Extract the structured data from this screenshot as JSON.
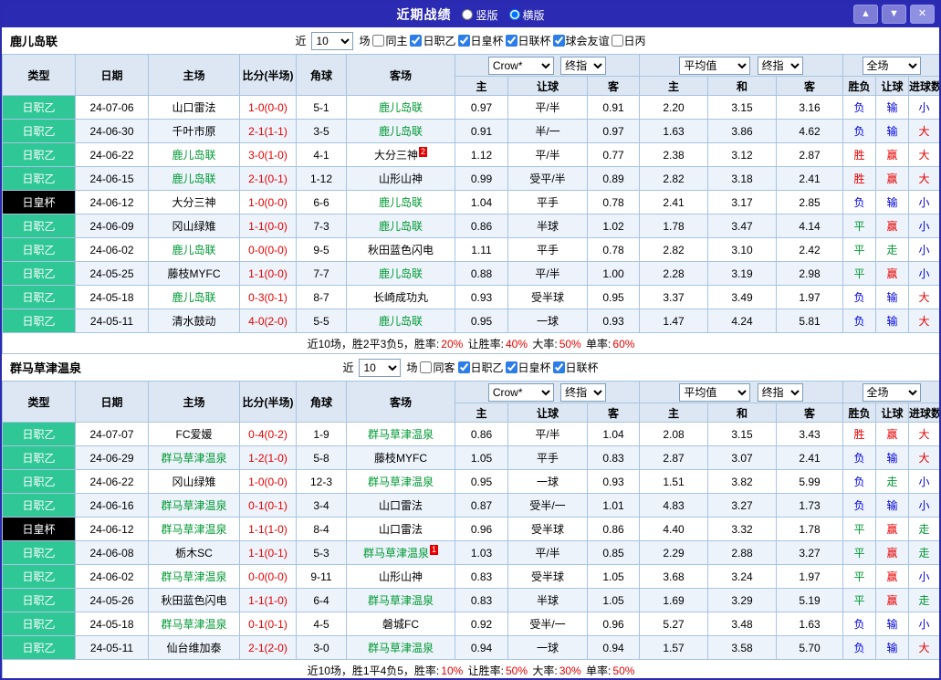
{
  "titlebar": {
    "title": "近期战绩",
    "layout_options": [
      {
        "label": "竖版",
        "selected": false
      },
      {
        "label": "横版",
        "selected": true
      }
    ],
    "buttons": [
      {
        "name": "scroll-up",
        "glyph": "▲"
      },
      {
        "name": "scroll-down",
        "glyph": "▼"
      },
      {
        "name": "close",
        "glyph": "✕"
      }
    ]
  },
  "table_header": {
    "cols": [
      "类型",
      "日期",
      "主场",
      "比分(半场)",
      "角球",
      "客场"
    ],
    "asian": {
      "bookmaker": "Crow*",
      "stage": "终指",
      "sub": [
        "主",
        "让球",
        "客"
      ]
    },
    "euro": {
      "source": "平均值",
      "stage": "终指",
      "sub": [
        "主",
        "和",
        "客"
      ]
    },
    "result": {
      "scope": "全场",
      "sub": [
        "胜负",
        "让球",
        "进球数"
      ]
    }
  },
  "league_colors": {
    "日职乙": "#2fc795",
    "日皇杯": "#000000"
  },
  "outcome_colors": {
    "胜": "r",
    "赢": "r",
    "大": "r",
    "负": "b",
    "输": "b",
    "小": "b",
    "平": "g",
    "走": "g"
  },
  "palette": {
    "r": "#e60000",
    "b": "#0000d9",
    "g": "#009933",
    "k": "#000000"
  },
  "sections": [
    {
      "team": "鹿儿岛联",
      "filters": {
        "near": "近",
        "count": "10",
        "games": "场",
        "same": {
          "label": "同主",
          "checked": false
        },
        "leagues": [
          {
            "label": "日职乙",
            "checked": true
          },
          {
            "label": "日皇杯",
            "checked": true
          },
          {
            "label": "日联杯",
            "checked": true
          },
          {
            "label": "球会友谊",
            "checked": true
          },
          {
            "label": "日丙",
            "checked": false
          }
        ]
      },
      "rows": [
        {
          "league": "日职乙",
          "date": "24-07-06",
          "home": "山口雷法",
          "home_focus": false,
          "score": "1-0(0-0)",
          "corner": "5-1",
          "away": "鹿儿岛联",
          "away_focus": true,
          "away_badge": "",
          "asian": [
            "0.97",
            "平/半",
            "0.91"
          ],
          "euro": [
            "2.20",
            "3.15",
            "3.16"
          ],
          "outcome": [
            "负",
            "输",
            "小"
          ]
        },
        {
          "league": "日职乙",
          "date": "24-06-30",
          "home": "千叶市原",
          "home_focus": false,
          "score": "2-1(1-1)",
          "corner": "3-5",
          "away": "鹿儿岛联",
          "away_focus": true,
          "away_badge": "",
          "asian": [
            "0.91",
            "半/一",
            "0.97"
          ],
          "euro": [
            "1.63",
            "3.86",
            "4.62"
          ],
          "outcome": [
            "负",
            "输",
            "大"
          ]
        },
        {
          "league": "日职乙",
          "date": "24-06-22",
          "home": "鹿儿岛联",
          "home_focus": true,
          "score": "3-0(1-0)",
          "corner": "4-1",
          "away": "大分三神",
          "away_focus": false,
          "away_badge": "2",
          "asian": [
            "1.12",
            "平/半",
            "0.77"
          ],
          "euro": [
            "2.38",
            "3.12",
            "2.87"
          ],
          "outcome": [
            "胜",
            "赢",
            "大"
          ]
        },
        {
          "league": "日职乙",
          "date": "24-06-15",
          "home": "鹿儿岛联",
          "home_focus": true,
          "score": "2-1(0-1)",
          "corner": "1-12",
          "away": "山形山神",
          "away_focus": false,
          "away_badge": "",
          "asian": [
            "0.99",
            "受平/半",
            "0.89"
          ],
          "euro": [
            "2.82",
            "3.18",
            "2.41"
          ],
          "outcome": [
            "胜",
            "赢",
            "大"
          ]
        },
        {
          "league": "日皇杯",
          "date": "24-06-12",
          "home": "大分三神",
          "home_focus": false,
          "score": "1-0(0-0)",
          "corner": "6-6",
          "away": "鹿儿岛联",
          "away_focus": true,
          "away_badge": "",
          "asian": [
            "1.04",
            "平手",
            "0.78"
          ],
          "euro": [
            "2.41",
            "3.17",
            "2.85"
          ],
          "outcome": [
            "负",
            "输",
            "小"
          ]
        },
        {
          "league": "日职乙",
          "date": "24-06-09",
          "home": "冈山绿雉",
          "home_focus": false,
          "score": "1-1(0-0)",
          "corner": "7-3",
          "away": "鹿儿岛联",
          "away_focus": true,
          "away_badge": "",
          "asian": [
            "0.86",
            "半球",
            "1.02"
          ],
          "euro": [
            "1.78",
            "3.47",
            "4.14"
          ],
          "outcome": [
            "平",
            "赢",
            "小"
          ]
        },
        {
          "league": "日职乙",
          "date": "24-06-02",
          "home": "鹿儿岛联",
          "home_focus": true,
          "score": "0-0(0-0)",
          "corner": "9-5",
          "away": "秋田蓝色闪电",
          "away_focus": false,
          "away_badge": "",
          "asian": [
            "1.11",
            "平手",
            "0.78"
          ],
          "euro": [
            "2.82",
            "3.10",
            "2.42"
          ],
          "outcome": [
            "平",
            "走",
            "小"
          ]
        },
        {
          "league": "日职乙",
          "date": "24-05-25",
          "home": "藤枝MYFC",
          "home_focus": false,
          "score": "1-1(0-0)",
          "corner": "7-7",
          "away": "鹿儿岛联",
          "away_focus": true,
          "away_badge": "",
          "asian": [
            "0.88",
            "平/半",
            "1.00"
          ],
          "euro": [
            "2.28",
            "3.19",
            "2.98"
          ],
          "outcome": [
            "平",
            "赢",
            "小"
          ]
        },
        {
          "league": "日职乙",
          "date": "24-05-18",
          "home": "鹿儿岛联",
          "home_focus": true,
          "score": "0-3(0-1)",
          "corner": "8-7",
          "away": "长崎成功丸",
          "away_focus": false,
          "away_badge": "",
          "asian": [
            "0.93",
            "受半球",
            "0.95"
          ],
          "euro": [
            "3.37",
            "3.49",
            "1.97"
          ],
          "outcome": [
            "负",
            "输",
            "大"
          ]
        },
        {
          "league": "日职乙",
          "date": "24-05-11",
          "home": "清水鼓动",
          "home_focus": false,
          "score": "4-0(2-0)",
          "corner": "5-5",
          "away": "鹿儿岛联",
          "away_focus": true,
          "away_badge": "",
          "asian": [
            "0.95",
            "一球",
            "0.93"
          ],
          "euro": [
            "1.47",
            "4.24",
            "5.81"
          ],
          "outcome": [
            "负",
            "输",
            "大"
          ]
        }
      ],
      "summary": [
        {
          "t": "近10场，胜2平3负5，胜率:",
          "c": "k"
        },
        {
          "t": "20%",
          "c": "r"
        },
        {
          "t": " 让胜率:",
          "c": "k"
        },
        {
          "t": "40%",
          "c": "r"
        },
        {
          "t": " 大率:",
          "c": "k"
        },
        {
          "t": "50%",
          "c": "r"
        },
        {
          "t": " 单率:",
          "c": "k"
        },
        {
          "t": "60%",
          "c": "r"
        }
      ]
    },
    {
      "team": "群马草津温泉",
      "filters": {
        "near": "近",
        "count": "10",
        "games": "场",
        "same": {
          "label": "同客",
          "checked": false
        },
        "leagues": [
          {
            "label": "日职乙",
            "checked": true
          },
          {
            "label": "日皇杯",
            "checked": true
          },
          {
            "label": "日联杯",
            "checked": true
          }
        ]
      },
      "rows": [
        {
          "league": "日职乙",
          "date": "24-07-07",
          "home": "FC爱媛",
          "home_focus": false,
          "score": "0-4(0-2)",
          "corner": "1-9",
          "away": "群马草津温泉",
          "away_focus": true,
          "away_badge": "",
          "asian": [
            "0.86",
            "平/半",
            "1.04"
          ],
          "euro": [
            "2.08",
            "3.15",
            "3.43"
          ],
          "outcome": [
            "胜",
            "赢",
            "大"
          ]
        },
        {
          "league": "日职乙",
          "date": "24-06-29",
          "home": "群马草津温泉",
          "home_focus": true,
          "score": "1-2(1-0)",
          "corner": "5-8",
          "away": "藤枝MYFC",
          "away_focus": false,
          "away_badge": "",
          "asian": [
            "1.05",
            "平手",
            "0.83"
          ],
          "euro": [
            "2.87",
            "3.07",
            "2.41"
          ],
          "outcome": [
            "负",
            "输",
            "大"
          ]
        },
        {
          "league": "日职乙",
          "date": "24-06-22",
          "home": "冈山绿雉",
          "home_focus": false,
          "score": "1-0(0-0)",
          "corner": "12-3",
          "away": "群马草津温泉",
          "away_focus": true,
          "away_badge": "",
          "asian": [
            "0.95",
            "一球",
            "0.93"
          ],
          "euro": [
            "1.51",
            "3.82",
            "5.99"
          ],
          "outcome": [
            "负",
            "走",
            "小"
          ]
        },
        {
          "league": "日职乙",
          "date": "24-06-16",
          "home": "群马草津温泉",
          "home_focus": true,
          "score": "0-1(0-1)",
          "corner": "3-4",
          "away": "山口雷法",
          "away_focus": false,
          "away_badge": "",
          "asian": [
            "0.87",
            "受半/一",
            "1.01"
          ],
          "euro": [
            "4.83",
            "3.27",
            "1.73"
          ],
          "outcome": [
            "负",
            "输",
            "小"
          ]
        },
        {
          "league": "日皇杯",
          "date": "24-06-12",
          "home": "群马草津温泉",
          "home_focus": true,
          "score": "1-1(1-0)",
          "corner": "8-4",
          "away": "山口雷法",
          "away_focus": false,
          "away_badge": "",
          "asian": [
            "0.96",
            "受半球",
            "0.86"
          ],
          "euro": [
            "4.40",
            "3.32",
            "1.78"
          ],
          "outcome": [
            "平",
            "赢",
            "走"
          ]
        },
        {
          "league": "日职乙",
          "date": "24-06-08",
          "home": "栃木SC",
          "home_focus": false,
          "score": "1-1(0-1)",
          "corner": "5-3",
          "away": "群马草津温泉",
          "away_focus": true,
          "away_badge": "1",
          "asian": [
            "1.03",
            "平/半",
            "0.85"
          ],
          "euro": [
            "2.29",
            "2.88",
            "3.27"
          ],
          "outcome": [
            "平",
            "赢",
            "走"
          ]
        },
        {
          "league": "日职乙",
          "date": "24-06-02",
          "home": "群马草津温泉",
          "home_focus": true,
          "score": "0-0(0-0)",
          "corner": "9-11",
          "away": "山形山神",
          "away_focus": false,
          "away_badge": "",
          "asian": [
            "0.83",
            "受半球",
            "1.05"
          ],
          "euro": [
            "3.68",
            "3.24",
            "1.97"
          ],
          "outcome": [
            "平",
            "赢",
            "小"
          ]
        },
        {
          "league": "日职乙",
          "date": "24-05-26",
          "home": "秋田蓝色闪电",
          "home_focus": false,
          "score": "1-1(1-0)",
          "corner": "6-4",
          "away": "群马草津温泉",
          "away_focus": true,
          "away_badge": "",
          "asian": [
            "0.83",
            "半球",
            "1.05"
          ],
          "euro": [
            "1.69",
            "3.29",
            "5.19"
          ],
          "outcome": [
            "平",
            "赢",
            "走"
          ]
        },
        {
          "league": "日职乙",
          "date": "24-05-18",
          "home": "群马草津温泉",
          "home_focus": true,
          "score": "0-1(0-1)",
          "corner": "4-5",
          "away": "磐城FC",
          "away_focus": false,
          "away_badge": "",
          "asian": [
            "0.92",
            "受半/一",
            "0.96"
          ],
          "euro": [
            "5.27",
            "3.48",
            "1.63"
          ],
          "outcome": [
            "负",
            "输",
            "小"
          ]
        },
        {
          "league": "日职乙",
          "date": "24-05-11",
          "home": "仙台维加泰",
          "home_focus": false,
          "score": "2-1(2-0)",
          "corner": "3-0",
          "away": "群马草津温泉",
          "away_focus": true,
          "away_badge": "",
          "asian": [
            "0.94",
            "一球",
            "0.94"
          ],
          "euro": [
            "1.57",
            "3.58",
            "5.70"
          ],
          "outcome": [
            "负",
            "输",
            "大"
          ]
        }
      ],
      "summary": [
        {
          "t": "近10场，胜1平4负5，胜率:",
          "c": "k"
        },
        {
          "t": "10%",
          "c": "r"
        },
        {
          "t": " 让胜率:",
          "c": "k"
        },
        {
          "t": "50%",
          "c": "r"
        },
        {
          "t": " 大率:",
          "c": "k"
        },
        {
          "t": "30%",
          "c": "r"
        },
        {
          "t": " 单率:",
          "c": "k"
        },
        {
          "t": "50%",
          "c": "r"
        }
      ]
    }
  ]
}
